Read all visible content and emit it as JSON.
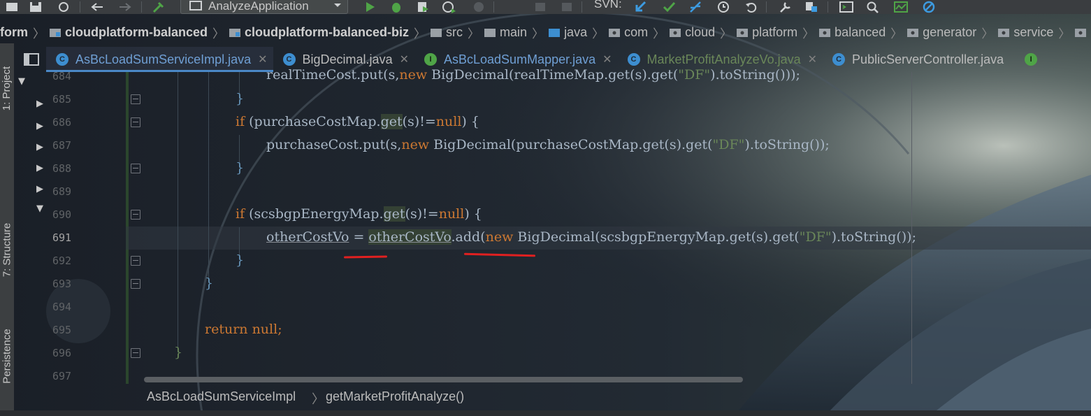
{
  "toolbar": {
    "run_config": "AnalyzeApplication",
    "svn_label": "SVN:",
    "icons": [
      "save-icon",
      "sync-icon",
      "back-icon",
      "forward-icon",
      "build-icon",
      "run-icon",
      "debug-icon",
      "coverage-icon",
      "profile-icon",
      "stop-icon",
      "svn-update-icon",
      "svn-commit-icon",
      "svn-compare-icon",
      "history-icon",
      "revert-icon",
      "settings-icon",
      "project-structure-icon",
      "terminal-icon",
      "search-icon",
      "monitor-icon",
      "no-entry-icon"
    ]
  },
  "breadcrumb": {
    "items": [
      {
        "label": "form",
        "bold": true
      },
      {
        "label": "cloudplatform-balanced",
        "bold": true
      },
      {
        "label": "cloudplatform-balanced-biz",
        "bold": true
      },
      {
        "label": "src"
      },
      {
        "label": "main"
      },
      {
        "label": "java"
      },
      {
        "label": "com"
      },
      {
        "label": "cloud"
      },
      {
        "label": "platform"
      },
      {
        "label": "balanced"
      },
      {
        "label": "generator"
      },
      {
        "label": "service"
      }
    ]
  },
  "tabs": [
    {
      "label": "AsBcLoadSumServiceImpl.java",
      "type": "C",
      "active": true,
      "color": "#6f9fd4"
    },
    {
      "label": "BigDecimal.java",
      "type": "C",
      "active": false,
      "color": "#bbbbbb"
    },
    {
      "label": "AsBcLoadSumMapper.java",
      "type": "I",
      "active": false,
      "color": "#6f9fd4"
    },
    {
      "label": "MarketProfitAnalyzeVo.java",
      "type": "C",
      "active": false,
      "color": "#6a8759"
    },
    {
      "label": "PublicServerController.java",
      "type": "C",
      "active": false,
      "color": "#bbbbbb"
    }
  ],
  "side_panels": {
    "project": "1: Project",
    "structure": "7: Structure",
    "persistence": "Persistence"
  },
  "editor": {
    "line_numbers": [
      "684",
      "685",
      "686",
      "687",
      "688",
      "689",
      "690",
      "691",
      "692",
      "693",
      "694",
      "695",
      "696",
      "697"
    ],
    "current_line": "691",
    "code": {
      "l684": {
        "a": "realTimeCost.put(s,",
        "kw": "new",
        "b": " BigDecimal(realTimeMap.get(s).get(",
        "str": "\"DF\"",
        "c": ").toString()));"
      },
      "l685": "}",
      "l686": {
        "kw": "if",
        "a": " (purchaseCostMap.",
        "get": "get",
        "b": "(s)!=",
        "nul": "null",
        "c": ") {"
      },
      "l687": {
        "a": "purchaseCost.put(s,",
        "kw": "new",
        "b": " BigDecimal(purchaseCostMap.get(s).get(",
        "str": "\"DF\"",
        "c": ").toString());"
      },
      "l688": "}",
      "l690": {
        "kw": "if",
        "a": " (scsbgpEnergyMap.",
        "get": "get",
        "b": "(s)!=",
        "nul": "null",
        "c": ") {"
      },
      "l691": {
        "v1": "otherCostVo",
        "eq": " = ",
        "v2": "otherCostVo",
        "a": ".add(",
        "kw": "new",
        "b": " BigDecimal(scsbgpEnergyMap.get(s).get(",
        "str": "\"DF\"",
        "c": ").toString());"
      },
      "l692": "}",
      "l693": "}",
      "l695": {
        "kw": "return",
        "nul": " null",
        "c": ";"
      },
      "l696": "}"
    }
  },
  "status_breadcrumb": {
    "class": "AsBcLoadSumServiceImpl",
    "method": "getMarketProfitAnalyze()"
  },
  "colors": {
    "keyword": "#cc7832",
    "string": "#6a8759",
    "annotation_red": "#e02020",
    "accent_blue": "#4a88c7"
  }
}
